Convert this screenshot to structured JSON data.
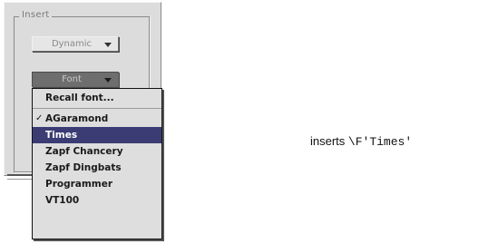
{
  "group_label": "Insert",
  "dynamic_popup": {
    "label": "Dynamic"
  },
  "font_popup": {
    "label": "Font"
  },
  "menu": {
    "items": [
      {
        "label": "Recall font...",
        "checked": false,
        "selected": false
      },
      {
        "label": "AGaramond",
        "checked": true,
        "selected": false
      },
      {
        "label": "Times",
        "checked": false,
        "selected": true
      },
      {
        "label": "Zapf Chancery",
        "checked": false,
        "selected": false
      },
      {
        "label": "Zapf Dingbats",
        "checked": false,
        "selected": false
      },
      {
        "label": "Programmer",
        "checked": false,
        "selected": false
      },
      {
        "label": "VT100",
        "checked": false,
        "selected": false
      }
    ],
    "checkmark": "✓",
    "selection_color": "#3b3c74"
  },
  "caption": {
    "text": "inserts",
    "code": "\\F'Times'"
  }
}
